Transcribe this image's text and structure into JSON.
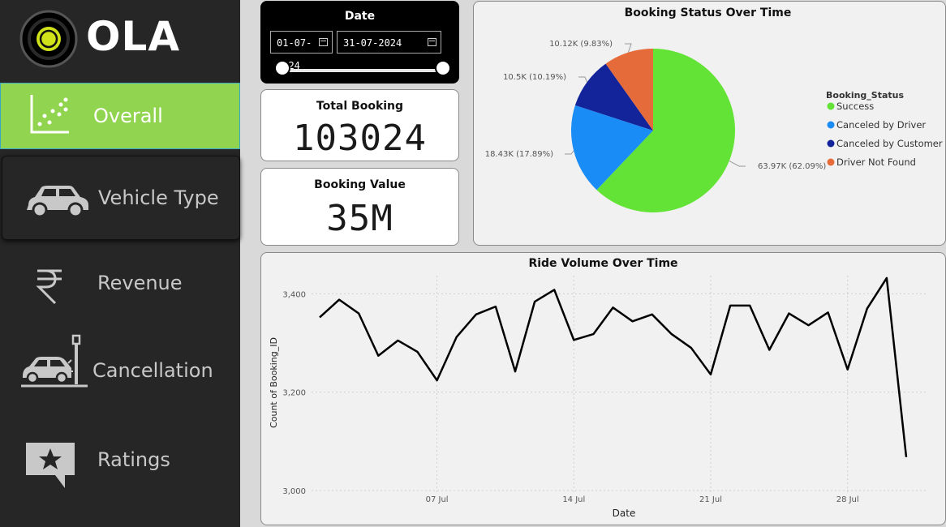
{
  "brand": {
    "name": "OLA"
  },
  "sidebar": {
    "items": [
      {
        "label": "Overall",
        "icon": "scatter-chart-icon",
        "active": true
      },
      {
        "label": "Vehicle Type",
        "icon": "car-icon"
      },
      {
        "label": "Revenue",
        "icon": "rupee-icon"
      },
      {
        "label": "Cancellation",
        "icon": "car-crash-icon"
      },
      {
        "label": "Ratings",
        "icon": "star-rating-icon"
      }
    ],
    "active_color": "#91d44f"
  },
  "date_filter": {
    "title": "Date",
    "start": "01-07-2024",
    "end": "31-07-2024"
  },
  "kpis": {
    "total_booking": {
      "title": "Total Booking",
      "value": "103024"
    },
    "booking_value": {
      "title": "Booking Value",
      "value": "35M"
    }
  },
  "chart_data": [
    {
      "type": "pie",
      "title": "Booking Status Over Time",
      "legend_title": "Booking_Status",
      "legend": "right",
      "slices": [
        {
          "name": "Success",
          "value": 63970,
          "label": "63.97K (62.09%)",
          "color": "#63e335"
        },
        {
          "name": "Canceled by Driver",
          "value": 18430,
          "label": "18.43K (17.89%)",
          "color": "#1a8cf5"
        },
        {
          "name": "Canceled by Customer",
          "value": 10500,
          "label": "10.5K (10.19%)",
          "color": "#13239a"
        },
        {
          "name": "Driver Not Found",
          "value": 10120,
          "label": "10.12K (9.83%)",
          "color": "#e56b3a"
        }
      ]
    },
    {
      "type": "line",
      "title": "Ride Volume Over Time",
      "xlabel": "Date",
      "ylabel": "Count of Booking_ID",
      "ylim": [
        3000,
        3450
      ],
      "yticks": [
        "3,000",
        "3,200",
        "3,400"
      ],
      "xticks": [
        "07 Jul",
        "14 Jul",
        "21 Jul",
        "28 Jul"
      ],
      "x": [
        "2024-07-01",
        "2024-07-02",
        "2024-07-03",
        "2024-07-04",
        "2024-07-05",
        "2024-07-06",
        "2024-07-07",
        "2024-07-08",
        "2024-07-09",
        "2024-07-10",
        "2024-07-11",
        "2024-07-12",
        "2024-07-13",
        "2024-07-14",
        "2024-07-15",
        "2024-07-16",
        "2024-07-17",
        "2024-07-18",
        "2024-07-19",
        "2024-07-20",
        "2024-07-21",
        "2024-07-22",
        "2024-07-23",
        "2024-07-24",
        "2024-07-25",
        "2024-07-26",
        "2024-07-27",
        "2024-07-28",
        "2024-07-29",
        "2024-07-30",
        "2024-07-31"
      ],
      "values": [
        3352,
        3388,
        3360,
        3274,
        3305,
        3282,
        3224,
        3312,
        3358,
        3374,
        3242,
        3384,
        3408,
        3306,
        3318,
        3372,
        3344,
        3358,
        3318,
        3290,
        3236,
        3376,
        3376,
        3286,
        3360,
        3336,
        3362,
        3246,
        3370,
        3432,
        3068
      ],
      "color": "#000000"
    }
  ]
}
